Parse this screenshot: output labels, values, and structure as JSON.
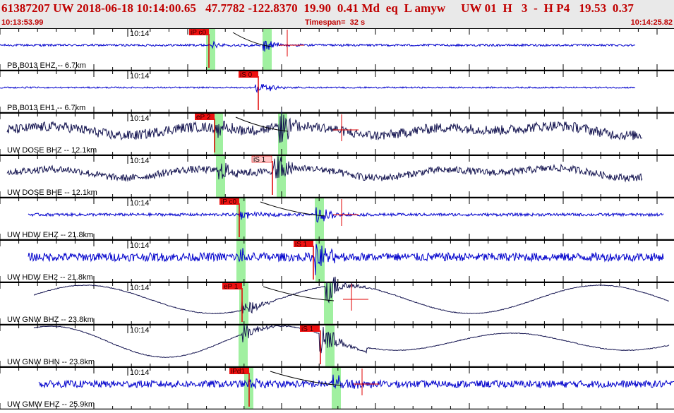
{
  "header": {
    "title": "61387207 UW 2018-06-18 10:14:00.65   47.7782 -122.8370  19.90  0.41 Md  eq  L amyw     UW 01  H   3  -  H P4   19.53  0.37",
    "start_time": "10:13:53.99",
    "timespan": "Timespan=  32 s",
    "end_time": "10:14:25.82"
  },
  "colors": {
    "blue_trace": "#0000cc",
    "navy_trace": "#141450",
    "pick_red": "#e00000",
    "pick_label_bg": "#ee1111",
    "pick_label_pale": "#ffc8c8",
    "green_window": "#a0f0a0",
    "header_text": "#c00000",
    "header_bg": "#e9e9e9"
  },
  "channels": [
    {
      "label": "PB B013 EHZ -- 6.7km",
      "time": "10:14",
      "pick": "iP c0",
      "color": "blue",
      "amp": 8,
      "noise": 1.5,
      "start": 0,
      "end": 900,
      "wave": "none",
      "green": [
        296,
        376
      ],
      "pickx": 296,
      "lblx": 268,
      "lblpale": false,
      "arrival": 300,
      "mainarrival": 374,
      "cross": 407,
      "curve": true
    },
    {
      "label": "PB B013 EH1 -- 6.7km",
      "time": "10:14",
      "pick": "iS 0",
      "color": "blue",
      "amp": 8,
      "noise": 1.0,
      "start": 0,
      "end": 900,
      "wave": "none",
      "green": [],
      "pickx": 366,
      "lblx": 338,
      "lblpale": false,
      "arrival": 362,
      "mainarrival": 366,
      "cross": 0,
      "curve": false
    },
    {
      "label": "UW DOSE BHZ -- 12.1km",
      "time": "10:14",
      "pick": "eP 2",
      "color": "navy",
      "amp": 26,
      "noise": 7,
      "start": 10,
      "end": 910,
      "wave": "mid",
      "green": [
        307,
        398
      ],
      "pickx": 304,
      "lblx": 276,
      "lblpale": false,
      "arrival": 304,
      "mainarrival": 398,
      "cross": 484,
      "curve": true
    },
    {
      "label": "UW DOSE BHE -- 12.1km",
      "time": "10:14",
      "pick": "iS 1",
      "color": "navy",
      "amp": 22,
      "noise": 5,
      "start": 10,
      "end": 910,
      "wave": "mid",
      "green": [
        310,
        396
      ],
      "pickx": 386,
      "lblx": 357,
      "lblpale": true,
      "arrival": 310,
      "mainarrival": 390,
      "cross": 0,
      "curve": false
    },
    {
      "label": "UW HDW EHZ -- 21.8km",
      "time": "10:14",
      "pick": "iP c0",
      "color": "blue",
      "amp": 12,
      "noise": 2,
      "start": 40,
      "end": 940,
      "wave": "none",
      "green": [
        339,
        450
      ],
      "pickx": 339,
      "lblx": 311,
      "lblpale": false,
      "arrival": 339,
      "mainarrival": 450,
      "cross": 484,
      "curve": true
    },
    {
      "label": "UW HDW EH2 -- 21.8km",
      "time": "10:14",
      "pick": "iS 1",
      "color": "blue",
      "amp": 20,
      "noise": 6,
      "start": 40,
      "end": 940,
      "wave": "none",
      "green": [
        339,
        451
      ],
      "pickx": 444,
      "lblx": 416,
      "lblpale": false,
      "arrival": 339,
      "mainarrival": 448,
      "cross": 0,
      "curve": false
    },
    {
      "label": "UW GNW BHZ -- 23.8km",
      "time": "10:14",
      "pick": "eP 1",
      "color": "navy",
      "amp": 26,
      "noise": 0.5,
      "start": 48,
      "end": 948,
      "wave": "long",
      "green": [
        343,
        463
      ],
      "pickx": 343,
      "lblx": 315,
      "lblpale": false,
      "arrival": 343,
      "mainarrival": 463,
      "cross": 498,
      "curve": true
    },
    {
      "label": "UW GNW BHN -- 23.8km",
      "time": "10:14",
      "pick": "iS 1",
      "color": "navy",
      "amp": 26,
      "noise": 0.5,
      "start": 48,
      "end": 948,
      "wave": "long2",
      "green": [
        342,
        465
      ],
      "pickx": 454,
      "lblx": 425,
      "lblpale": false,
      "arrival": 342,
      "mainarrival": 455,
      "cross": 0,
      "curve": false
    },
    {
      "label": "UW GMW EHZ -- 25.9km",
      "time": "10:14",
      "pick": "iPd1",
      "color": "blue",
      "amp": 14,
      "noise": 5,
      "start": 55,
      "end": 955,
      "wave": "none",
      "green": [
        350,
        474
      ],
      "pickx": 353,
      "lblx": 325,
      "lblpale": false,
      "arrival": 353,
      "mainarrival": 474,
      "cross": 513,
      "curve": true
    }
  ]
}
